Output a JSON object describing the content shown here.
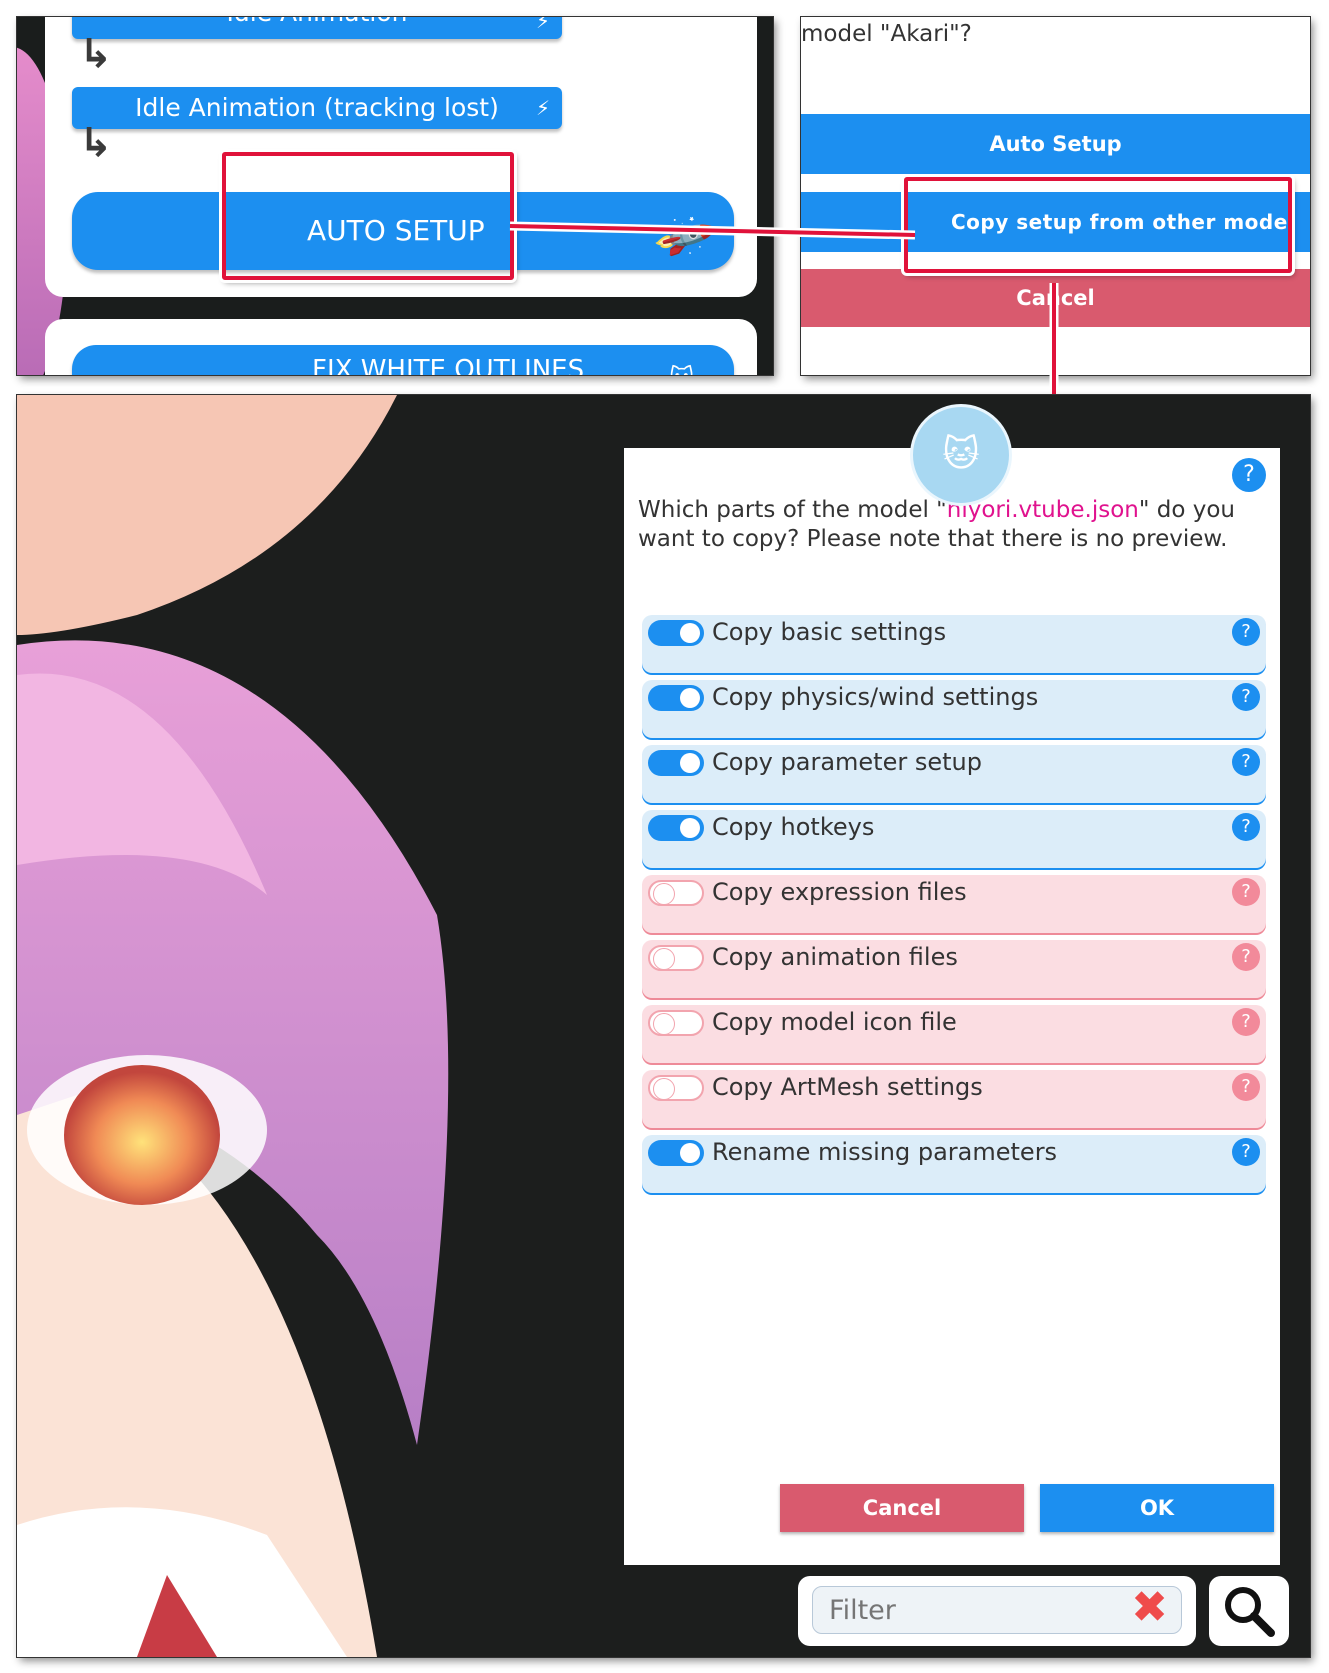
{
  "top_left": {
    "idle_animation_label": "Idle Animation",
    "idle_tracking_lost_label": "Idle Animation (tracking lost)",
    "auto_setup_label": "AUTO SETUP",
    "fix_outlines_label": "FIX WHITE OUTLINES"
  },
  "top_right": {
    "question_fragment": "model \"Akari\"?",
    "auto_setup_label": "Auto Setup",
    "copy_setup_label": "Copy setup from other model",
    "cancel_label": "Cancel"
  },
  "dialog": {
    "question_prefix": "Which parts of the model \"",
    "model_name": "hiyori.vtube.json",
    "question_suffix": "\" do you want to copy? Please note that there is no preview.",
    "help_label": "?",
    "options": [
      {
        "label": "Copy basic settings",
        "enabled": true
      },
      {
        "label": "Copy physics/wind settings",
        "enabled": true
      },
      {
        "label": "Copy parameter setup",
        "enabled": true
      },
      {
        "label": "Copy hotkeys",
        "enabled": true
      },
      {
        "label": "Copy expression files",
        "enabled": false
      },
      {
        "label": "Copy animation files",
        "enabled": false
      },
      {
        "label": "Copy model icon file",
        "enabled": false
      },
      {
        "label": "Copy ArtMesh settings",
        "enabled": false
      },
      {
        "label": "Rename missing parameters",
        "enabled": true
      }
    ],
    "cancel_label": "Cancel",
    "ok_label": "OK"
  },
  "filter": {
    "placeholder": "Filter"
  },
  "colors": {
    "accent_blue": "#1c8ff0",
    "cancel_red": "#d95a6e",
    "highlight_red": "#e0123a",
    "filename_magenta": "#e0128e"
  }
}
